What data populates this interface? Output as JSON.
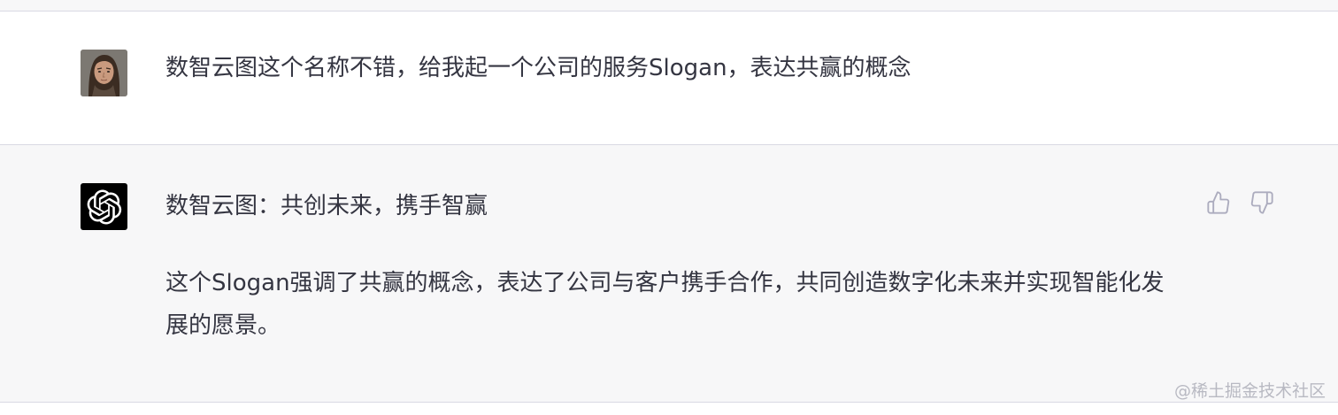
{
  "conversation": {
    "user_message": {
      "avatar": "user-portrait-avatar",
      "text": "数智云图这个名称不错，给我起一个公司的服务Slogan，表达共赢的概念"
    },
    "assistant_message": {
      "avatar": "openai-logo-icon",
      "title": "数智云图：共创未来，携手智赢",
      "body": "这个Slogan强调了共赢的概念，表达了公司与客户携手合作，共同创造数字化未来并实现智能化发展的愿景。",
      "actions": {
        "like_icon": "thumbs-up-icon",
        "dislike_icon": "thumbs-down-icon"
      }
    }
  },
  "watermark": "@稀土掘金技术社区",
  "colors": {
    "text": "#343541",
    "assistant_bg": "#f7f7f8",
    "divider": "#d9d9e3",
    "icon_gray": "#acacbe",
    "watermark": "#b8b9c2"
  }
}
